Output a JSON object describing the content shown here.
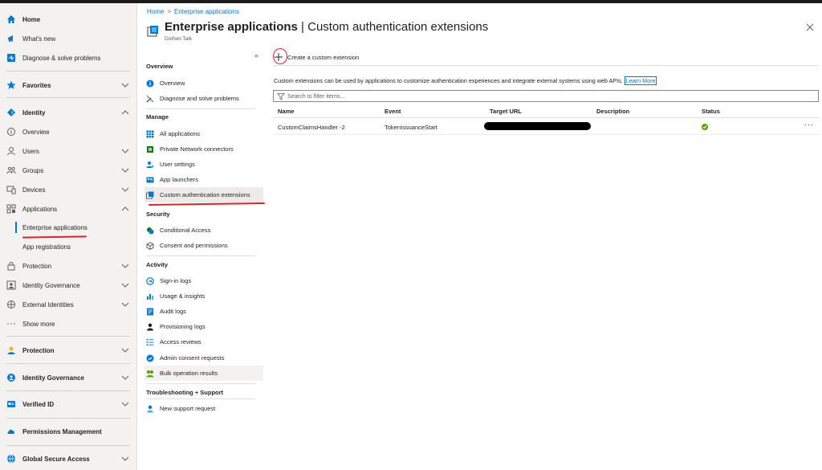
{
  "left_nav": {
    "home": "Home",
    "whats_new": "What's new",
    "diagnose": "Diagnose & solve problems",
    "favorites": "Favorites",
    "identity": "Identity",
    "overview": "Overview",
    "users": "Users",
    "groups": "Groups",
    "devices": "Devices",
    "applications": "Applications",
    "enterprise_applications": "Enterprise applications",
    "app_registrations": "App registrations",
    "protection": "Protection",
    "identity_governance": "Identity Governance",
    "external_identities": "External Identities",
    "show_more": "Show more",
    "protection_section": "Protection",
    "identity_governance_section": "Identity Governance",
    "verified_id": "Verified ID",
    "permissions_management": "Permissions Management",
    "global_secure_access": "Global Secure Access"
  },
  "breadcrumb": {
    "home": "Home",
    "separator": ">",
    "current": "Enterprise applications"
  },
  "header": {
    "title_bold": "Enterprise applications",
    "title_rest": " | Custom authentication extensions",
    "subtitle": "DotNet-Talk",
    "more": "···",
    "collapse": "«"
  },
  "resource_menu": {
    "overview_head": "Overview",
    "overview": "Overview",
    "diagnose": "Diagnose and solve problems",
    "manage_head": "Manage",
    "all_applications": "All applications",
    "private_network": "Private Network connectors",
    "user_settings": "User settings",
    "app_launchers": "App launchers",
    "custom_auth_ext": "Custom authentication extensions",
    "security_head": "Security",
    "conditional_access": "Conditional Access",
    "consent": "Consent and permissions",
    "activity_head": "Activity",
    "signin_logs": "Sign-in logs",
    "usage_insights": "Usage & insights",
    "audit_logs": "Audit logs",
    "provisioning_logs": "Provisioning logs",
    "access_reviews": "Access reviews",
    "admin_consent": "Admin consent requests",
    "bulk_ops": "Bulk operation results",
    "troubleshooting_head": "Troubleshooting + Support",
    "new_support": "New support request"
  },
  "content": {
    "create_label": "Create a custom extension",
    "description": "Custom extensions can be used by applications to customize authentication experiences and integrate external systems using web APIs.",
    "learn_more": "Learn More",
    "filter_placeholder": "Search to filter items...",
    "columns": {
      "name": "Name",
      "event": "Event",
      "target_url": "Target URL",
      "description": "Description",
      "status": "Status"
    },
    "rows": [
      {
        "name": "CustomClaimsHandler -2",
        "event": "TokenIssuanceStart",
        "target_url": "",
        "description": "",
        "status": "success",
        "more": "···"
      }
    ]
  },
  "colors": {
    "accent": "#0078d4",
    "annotation_red": "#e02424",
    "status_green": "#57a300"
  }
}
